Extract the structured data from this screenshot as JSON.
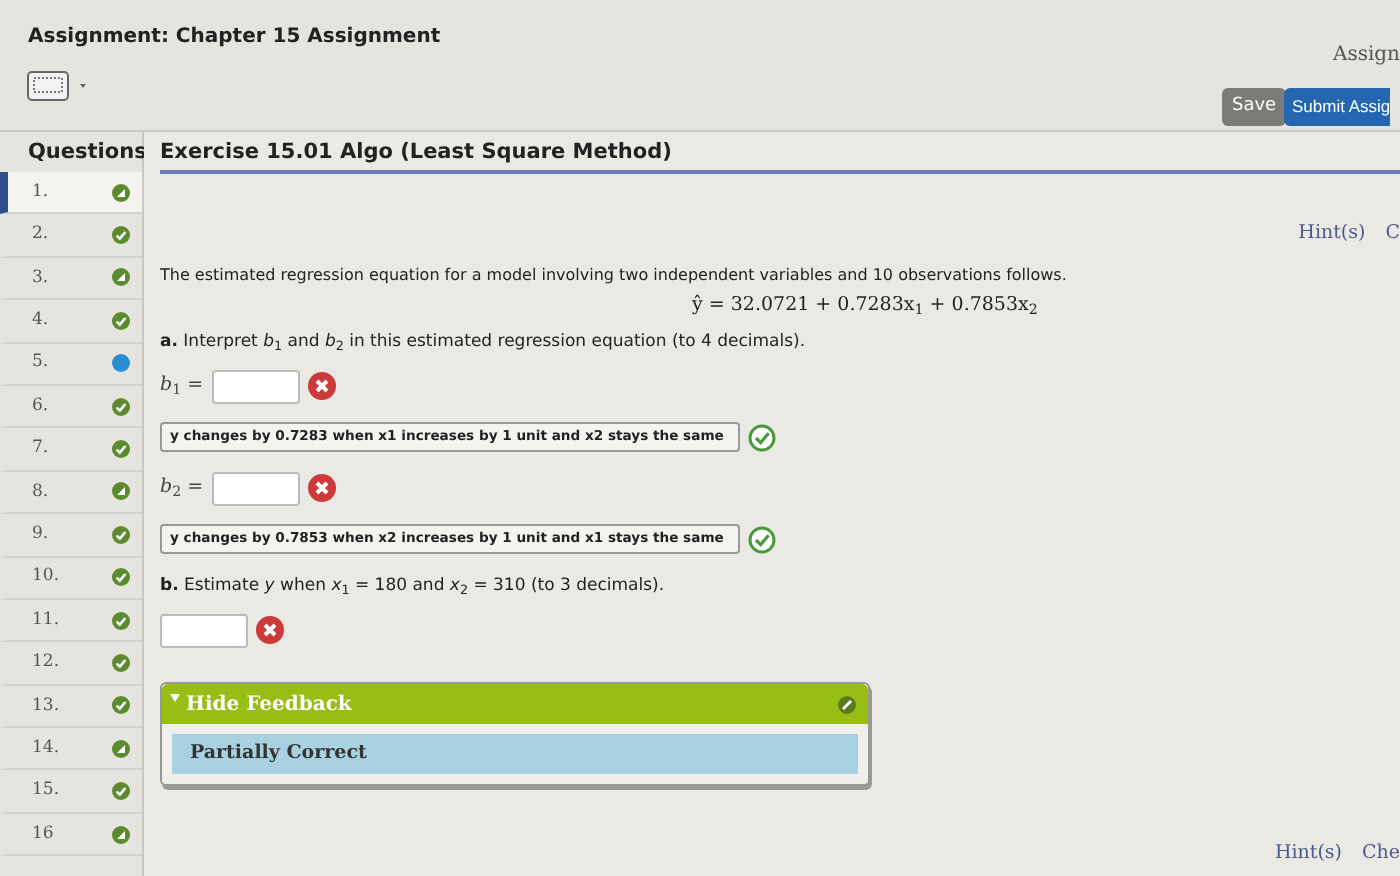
{
  "header": {
    "title": "Assignment: Chapter 15 Assignment",
    "right_label": "Assign",
    "save": "Save",
    "submit": "Submit Assig"
  },
  "sidebar": {
    "heading": "Questions",
    "items": [
      {
        "number": "1.",
        "kind": "partial",
        "selected": true
      },
      {
        "number": "2.",
        "kind": "complete",
        "selected": false
      },
      {
        "number": "3.",
        "kind": "partial",
        "selected": false
      },
      {
        "number": "4.",
        "kind": "complete",
        "selected": false
      },
      {
        "number": "5.",
        "kind": "unanswered",
        "selected": false
      },
      {
        "number": "6.",
        "kind": "complete",
        "selected": false
      },
      {
        "number": "7.",
        "kind": "complete",
        "selected": false
      },
      {
        "number": "8.",
        "kind": "partial",
        "selected": false
      },
      {
        "number": "9.",
        "kind": "complete",
        "selected": false
      },
      {
        "number": "10.",
        "kind": "complete",
        "selected": false
      },
      {
        "number": "11.",
        "kind": "complete",
        "selected": false
      },
      {
        "number": "12.",
        "kind": "complete",
        "selected": false
      },
      {
        "number": "13.",
        "kind": "complete",
        "selected": false
      },
      {
        "number": "14.",
        "kind": "partial",
        "selected": false
      },
      {
        "number": "15.",
        "kind": "complete",
        "selected": false
      },
      {
        "number": "16",
        "kind": "partial",
        "selected": false
      }
    ]
  },
  "exercise": {
    "title": "Exercise 15.01 Algo (Least Square Method)",
    "hint": "Hint(s)",
    "hint_cut": "C",
    "intro": "The estimated regression equation for a model involving two independent variables and 10 observations follows.",
    "equation": "ŷ = 32.0721 + 0.7283x$_{1}$ + 0.7853x$_{2}$",
    "parts": [
      {
        "kind": "text",
        "text": "**a.** Interpret *b*$_{1}$ and *b*$_{2}$ in this estimated regression equation (to 4 decimals)."
      },
      {
        "kind": "input",
        "label": "*b*$_{1}$ =",
        "correct": false
      },
      {
        "kind": "select",
        "value": "y changes by 0.7283 when x1 increases by 1 unit and x2 stays the same",
        "correct": true
      },
      {
        "kind": "input",
        "label": "*b*$_{2}$ =",
        "correct": false
      },
      {
        "kind": "select",
        "value": "y changes by 0.7853 when x2 increases by 1 unit and x1 stays the same",
        "correct": true
      },
      {
        "kind": "text",
        "text": "**b.** Estimate *y* when *x*$_{1}$ = 180 and *x*$_{2}$ = 310 (to 3 decimals)."
      },
      {
        "kind": "input",
        "correct": false
      }
    ],
    "feedback": {
      "toggle": "Hide Feedback",
      "result": "Partially Correct"
    },
    "bottom_hint": "Hint(s)",
    "bottom_cut": "Che"
  }
}
